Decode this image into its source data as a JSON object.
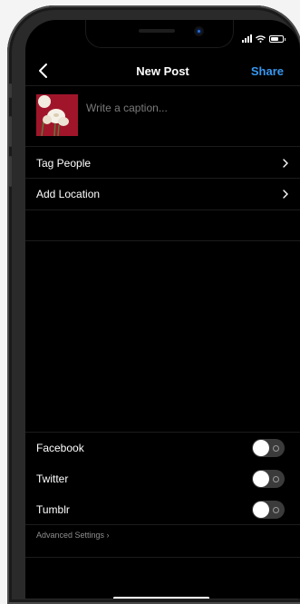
{
  "header": {
    "title": "New Post",
    "share_label": "Share"
  },
  "compose": {
    "caption_placeholder": "Write a caption..."
  },
  "options": [
    {
      "label": "Tag People"
    },
    {
      "label": "Add Location"
    }
  ],
  "share_to": [
    {
      "label": "Facebook",
      "enabled": false
    },
    {
      "label": "Twitter",
      "enabled": false
    },
    {
      "label": "Tumblr",
      "enabled": false
    }
  ],
  "advanced": {
    "label": "Advanced Settings ›"
  },
  "colors": {
    "accent": "#3897f0",
    "background": "#000000",
    "toggle_off": "#3b3b3b"
  },
  "icons": [
    "back-chevron-icon",
    "chevron-right-icon",
    "signal-icon",
    "wifi-icon",
    "battery-icon"
  ]
}
